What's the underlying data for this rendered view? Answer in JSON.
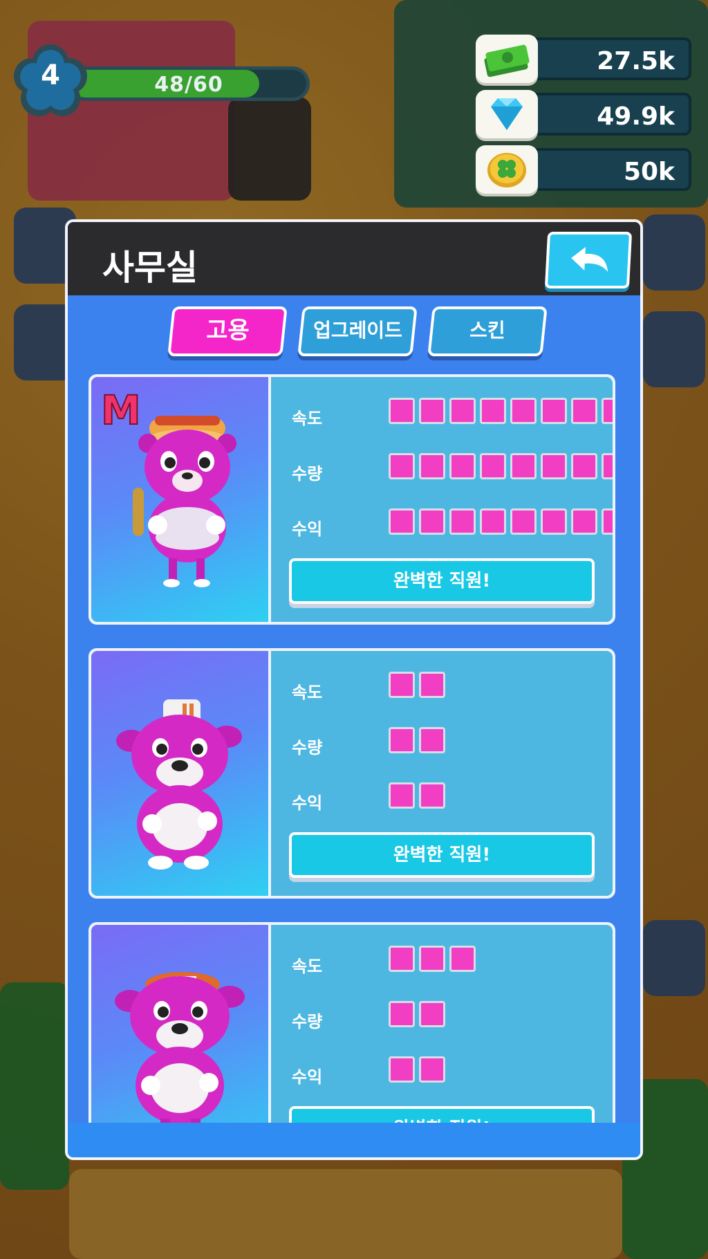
{
  "hud": {
    "level": "4",
    "xp_text": "48/60",
    "xp_progress": 0.8,
    "currencies": [
      {
        "icon": "cash-icon",
        "value": "27.5k"
      },
      {
        "icon": "diamond-icon",
        "value": "49.9k"
      },
      {
        "icon": "clover-coin-icon",
        "value": "50k"
      }
    ]
  },
  "modal": {
    "title": "사무실",
    "back_icon": "back-arrow-icon",
    "tabs": [
      {
        "label": "고용",
        "active": true
      },
      {
        "label": "업그레이드",
        "active": false
      },
      {
        "label": "스킨",
        "active": false
      }
    ]
  },
  "staff": [
    {
      "badge": "M",
      "character": "bear-with-hotdog-hat",
      "stats": [
        {
          "label": "속도",
          "level": 8
        },
        {
          "label": "수량",
          "level": 8
        },
        {
          "label": "수익",
          "level": 8
        }
      ],
      "button": "완벽한 직원!"
    },
    {
      "character": "bulldog-with-chef-hat",
      "stats": [
        {
          "label": "속도",
          "level": 2
        },
        {
          "label": "수량",
          "level": 2
        },
        {
          "label": "수익",
          "level": 2
        }
      ],
      "button": "완벽한 직원!"
    },
    {
      "character": "bulldog-with-cap",
      "stats": [
        {
          "label": "속도",
          "level": 3
        },
        {
          "label": "수량",
          "level": 2
        },
        {
          "label": "수익",
          "level": 2
        }
      ],
      "button": "완벽한 직원!"
    }
  ],
  "colors": {
    "pip": "#f23ec2",
    "active_tab": "#f526c9",
    "inactive_tab": "#2f9fd9",
    "panel": "#3b82ef",
    "card": "#4db7e1"
  }
}
